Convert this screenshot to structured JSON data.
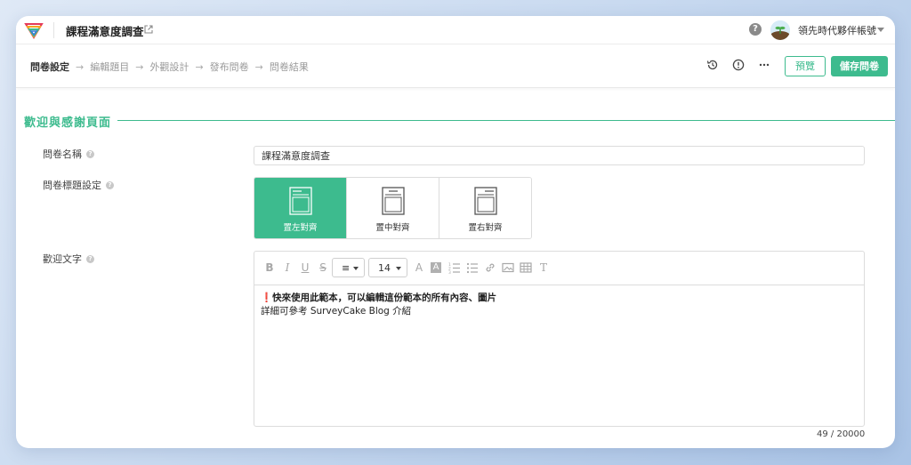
{
  "header": {
    "survey_title": "課程滿意度調查",
    "account_name": "領先時代夥伴帳號",
    "icons": [
      "logo-icon",
      "external-link-icon",
      "help-icon",
      "avatar",
      "caret-down-icon"
    ]
  },
  "steps": {
    "items": [
      "問卷設定",
      "編輯題目",
      "外觀設計",
      "發布問卷",
      "問卷結果"
    ],
    "active_index": 0,
    "arrow": "→"
  },
  "toolbar": {
    "preview_label": "預覽",
    "save_label": "儲存問卷",
    "icons": [
      "history-icon",
      "info-icon",
      "more-icon"
    ]
  },
  "section": {
    "title": "歡迎與感謝頁面"
  },
  "form": {
    "name_label": "問卷名稱",
    "name_value": "課程滿意度調查",
    "title_setting_label": "問卷標題設定",
    "align_options": [
      "置左對齊",
      "置中對齊",
      "置右對齊"
    ],
    "align_selected": "置左對齊",
    "welcome_label": "歡迎文字"
  },
  "editor": {
    "bold_glyph": "B",
    "italic_glyph": "I",
    "underline_glyph": "U",
    "strike_glyph": "S",
    "align_value": "≡",
    "font_size": "14",
    "font_color_glyph": "A",
    "bg_color_glyph": "A",
    "clear_format_glyph": "T",
    "content_line1_mark": "❗",
    "content_line1": "快來使用此範本，可以編輯這份範本的所有內容、圖片",
    "content_line2": "詳細可參考 SurveyCake Blog 介紹",
    "char_count": "49 / 20000"
  },
  "colors": {
    "accent": "#3dbb8e",
    "text": "#333333",
    "border": "#dcdcdc"
  }
}
